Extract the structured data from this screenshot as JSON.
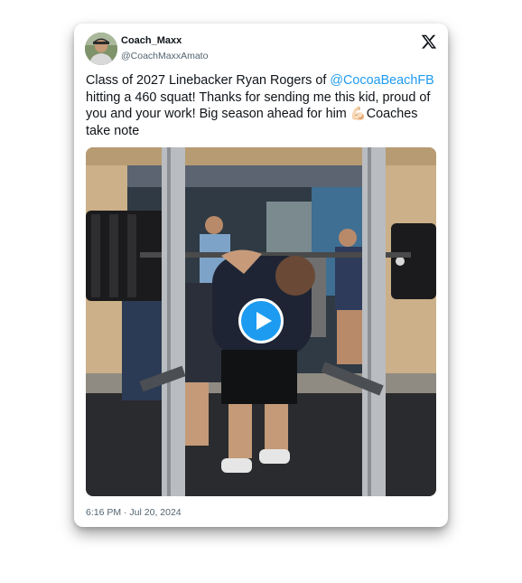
{
  "tweet": {
    "display_name": "Coach_Maxx",
    "handle": "@CoachMaxxAmato",
    "text_part1": "Class of 2027 Linebacker Ryan Rogers of ",
    "mention": "@CocoaBeachFB",
    "text_part2": " hitting a 460 squat! Thanks for sending me this kid, proud of you and your work! Big season ahead for him ",
    "emoji": "💪🏻",
    "text_part3": "Coaches take note",
    "timestamp": "6:16 PM · Jul 20, 2024"
  },
  "icons": {
    "brand": "x-logo-icon",
    "play": "play-icon",
    "emoji": "flexed-biceps-icon"
  },
  "colors": {
    "link": "#1d9bf0",
    "text": "#0f1419",
    "muted": "#536471",
    "play_button": "#1d9bf0"
  }
}
